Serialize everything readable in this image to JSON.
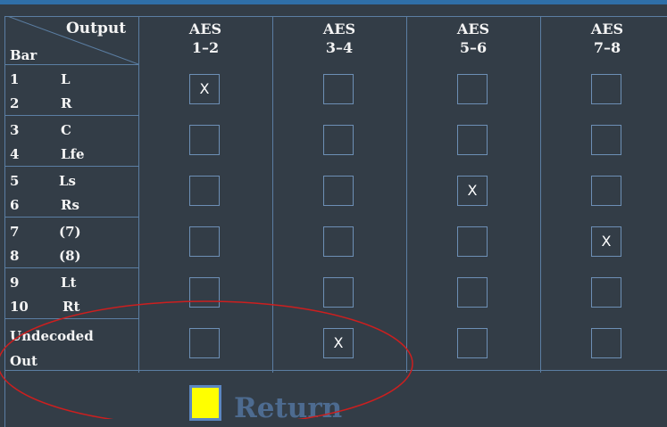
{
  "header": {
    "output_label": "Output",
    "bar_label": "Bar"
  },
  "columns": [
    {
      "line1": "AES",
      "line2": "1–2"
    },
    {
      "line1": "AES",
      "line2": "3–4"
    },
    {
      "line1": "AES",
      "line2": "5–6"
    },
    {
      "line1": "AES",
      "line2": "7–8"
    }
  ],
  "rows": [
    {
      "n1": "1",
      "l1": "L",
      "n2": "2",
      "l2": "R",
      "checked": [
        true,
        false,
        false,
        false
      ]
    },
    {
      "n1": "3",
      "l1": "C",
      "n2": "4",
      "l2": "Lfe",
      "checked": [
        false,
        false,
        false,
        false
      ]
    },
    {
      "n1": "5",
      "l1": "Ls",
      "n2": "6",
      "l2": "Rs",
      "checked": [
        false,
        false,
        true,
        false
      ]
    },
    {
      "n1": "7",
      "l1": "(7)",
      "n2": "8",
      "l2": "(8)",
      "checked": [
        false,
        false,
        false,
        true
      ]
    },
    {
      "n1": "9",
      "l1": "Lt",
      "n2": "10",
      "l2": "Rt",
      "checked": [
        false,
        false,
        false,
        false
      ]
    },
    {
      "line1": "Undecoded",
      "line2": "Out",
      "checked": [
        false,
        true,
        false,
        false
      ]
    }
  ],
  "check_mark": "X",
  "return_label": "Return",
  "colors": {
    "background": "#333d47",
    "grid": "#5b7ea3",
    "checkbox_border": "#6d8fb5",
    "return_button": "#ffff00",
    "return_text": "#4d6b90",
    "annotation": "#cc1f1f"
  }
}
